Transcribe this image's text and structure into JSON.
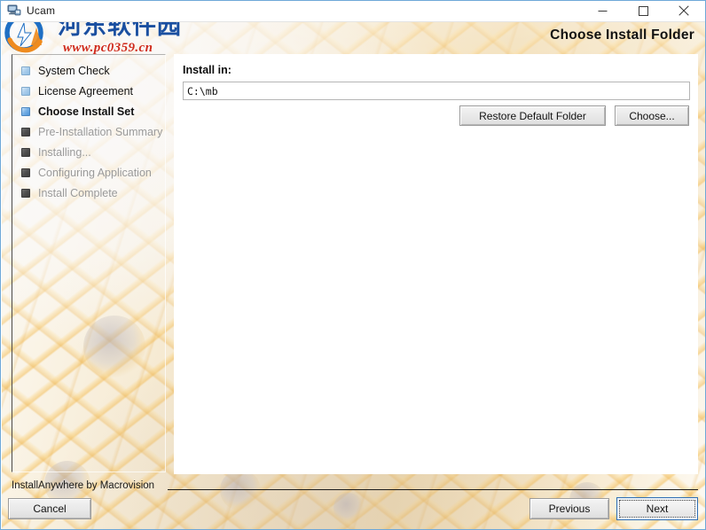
{
  "window": {
    "title": "Ucam",
    "app_icon": "computer-icon",
    "controls": {
      "minimize": "minimize-icon",
      "maximize": "maximize-icon",
      "close": "close-icon"
    }
  },
  "watermark": {
    "chinese": "河东软件园",
    "url": "www.pc0359.cn"
  },
  "header": {
    "title": "Choose Install Folder"
  },
  "sidebar": {
    "items": [
      {
        "label": "System Check",
        "state": "done-light"
      },
      {
        "label": "License Agreement",
        "state": "done-light"
      },
      {
        "label": "Choose Install Set",
        "state": "current"
      },
      {
        "label": "Pre-Installation Summary",
        "state": "pending"
      },
      {
        "label": "Installing...",
        "state": "pending"
      },
      {
        "label": "Configuring Application",
        "state": "pending"
      },
      {
        "label": "Install Complete",
        "state": "pending"
      }
    ]
  },
  "main": {
    "install_in_label": "Install in:",
    "path_value": "C:\\mb",
    "path_placeholder": "",
    "restore_default_label": "Restore Default Folder",
    "choose_label": "Choose..."
  },
  "footer": {
    "brand": "InstallAnywhere by Macrovision",
    "cancel_label": "Cancel",
    "previous_label": "Previous",
    "next_label": "Next"
  },
  "colors": {
    "accent_blue": "#2f6fb5",
    "watermark_blue": "#1a4fa0",
    "watermark_red": "#cf2a1b",
    "window_border": "#6ea8d8",
    "pattern_gold": "#f3bd58"
  }
}
